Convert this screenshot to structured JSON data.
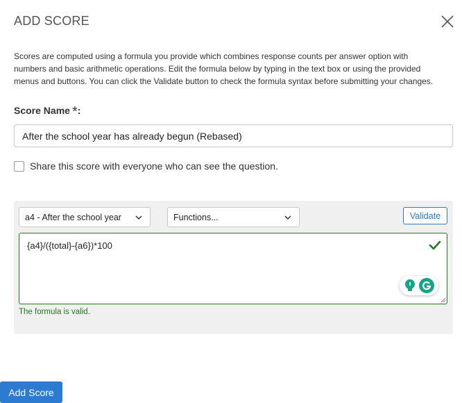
{
  "dialog": {
    "title": "ADD SCORE",
    "description": "Scores are computed using a formula you provide which combines response counts per answer option with numbers and basic arithmetic operations. Edit the formula below by typing in the text box or using the provided menus and buttons. You can click the Validate button to check the formula syntax before submitting your changes."
  },
  "score_name": {
    "label": "Score Name",
    "required_mark": "*",
    "colon": ":",
    "value": "After the school year has already begun (Rebased)"
  },
  "share": {
    "label": "Share this score with everyone who can see the question.",
    "checked": false
  },
  "formula": {
    "variable_select": "a4 - After the school year",
    "functions_select": "Functions...",
    "validate_label": "Validate",
    "value": "{a4}/({total}-{a6})*100",
    "status_message": "The formula is valid."
  },
  "footer": {
    "add_label": "Add Score"
  },
  "colors": {
    "primary": "#2d7ad1",
    "valid": "#1f7a1f",
    "panel_bg": "#f0f0f0"
  }
}
